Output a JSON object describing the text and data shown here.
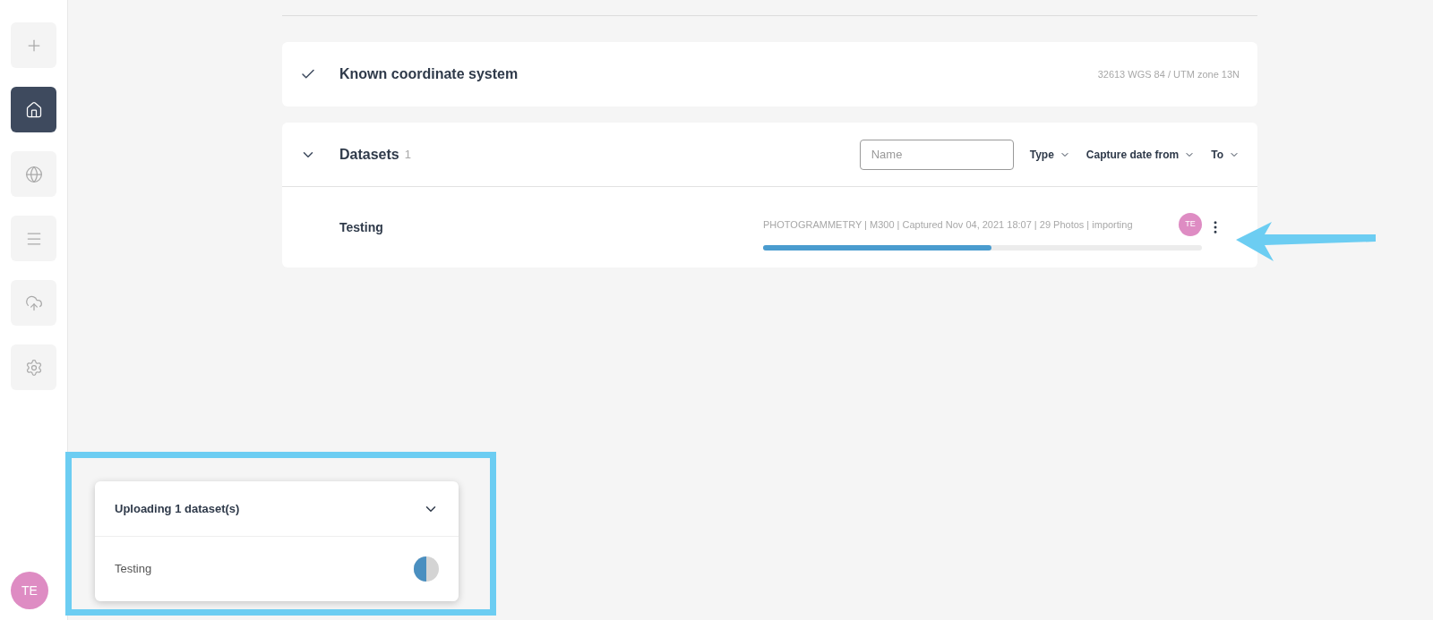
{
  "sidebar": {
    "items": [
      {
        "selected": false
      },
      {
        "selected": true
      },
      {
        "selected": false
      },
      {
        "selected": false
      },
      {
        "selected": false
      },
      {
        "selected": false
      }
    ],
    "avatar": "TE"
  },
  "coordinate_system": {
    "title": "Known coordinate system",
    "value": "32613 WGS 84 / UTM zone 13N",
    "checked": true
  },
  "datasets": {
    "title": "Datasets",
    "count": "1",
    "expanded": true,
    "filters": {
      "name_placeholder": "Name",
      "dropdowns": [
        "Type",
        "Capture date from",
        "To"
      ]
    },
    "rows": [
      {
        "name": "Testing",
        "meta": "PHOTOGRAMMETRY | M300 | Captured Nov 04, 2021 18:07 | 29 Photos | importing",
        "avatar": "TE",
        "level": 0.52
      }
    ]
  },
  "upload_panel": {
    "title": "Uploading 1 dataset(s)",
    "expanded": true,
    "items": [
      {
        "name": "Testing",
        "level": 0.5
      }
    ]
  }
}
